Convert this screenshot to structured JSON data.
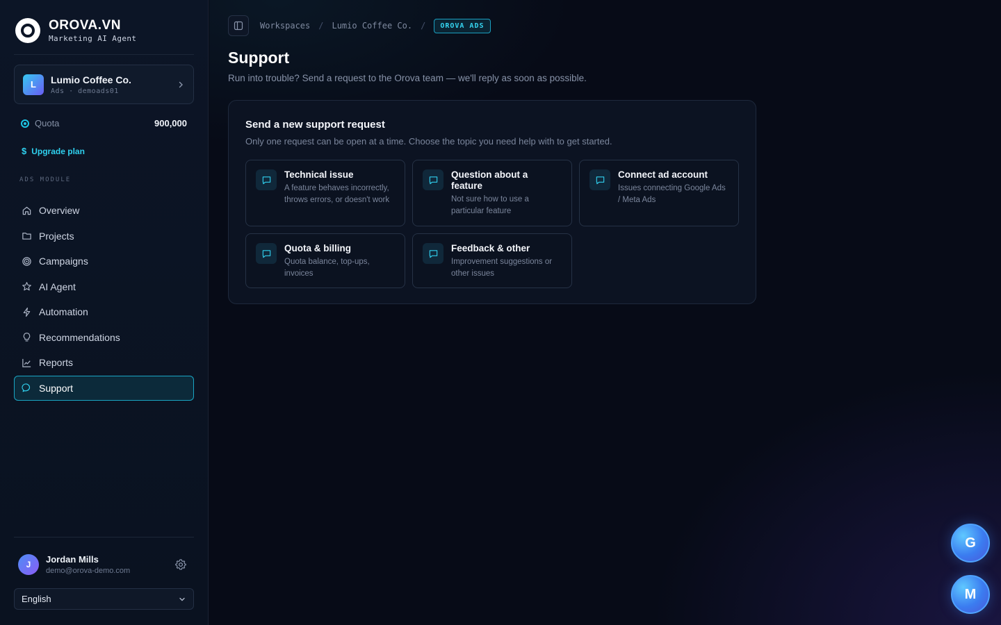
{
  "brand": {
    "name": "OROVA.VN",
    "subtitle": "Marketing AI Agent"
  },
  "workspace": {
    "initial": "L",
    "name": "Lumio Coffee Co.",
    "meta": "Ads · demoads01"
  },
  "quota": {
    "label": "Quota",
    "value": "900,000"
  },
  "upgrade": {
    "symbol": "$",
    "label": "Upgrade plan"
  },
  "sidebar": {
    "module_label": "ADS MODULE",
    "items": [
      {
        "label": "Overview",
        "icon": "home-icon"
      },
      {
        "label": "Projects",
        "icon": "folder-icon"
      },
      {
        "label": "Campaigns",
        "icon": "target-icon"
      },
      {
        "label": "AI Agent",
        "icon": "star-icon"
      },
      {
        "label": "Automation",
        "icon": "bolt-icon"
      },
      {
        "label": "Recommendations",
        "icon": "lightbulb-icon"
      },
      {
        "label": "Reports",
        "icon": "line-chart-icon"
      },
      {
        "label": "Support",
        "icon": "chat-icon",
        "active": true
      }
    ]
  },
  "user": {
    "initial": "J",
    "name": "Jordan Mills",
    "email": "demo@orova-demo.com"
  },
  "language": {
    "selected": "English"
  },
  "breadcrumb": {
    "items": [
      "Workspaces",
      "Lumio Coffee Co."
    ],
    "separator": "/",
    "badge": "OROVA ADS"
  },
  "page": {
    "title": "Support",
    "subtitle": "Run into trouble? Send a request to the Orova team — we'll reply as soon as possible."
  },
  "request_card": {
    "title": "Send a new support request",
    "subtitle": "Only one request can be open at a time. Choose the topic you need help with to get started.",
    "topics": [
      {
        "title": "Technical issue",
        "desc": "A feature behaves incorrectly, throws errors, or doesn't work"
      },
      {
        "title": "Question about a feature",
        "desc": "Not sure how to use a particular feature"
      },
      {
        "title": "Connect ad account",
        "desc": "Issues connecting Google Ads / Meta Ads"
      },
      {
        "title": "Quota & billing",
        "desc": "Quota balance, top-ups, invoices"
      },
      {
        "title": "Feedback & other",
        "desc": "Improvement suggestions or other issues"
      }
    ]
  },
  "floating": {
    "top_label": "G",
    "bottom_label": "M"
  },
  "colors": {
    "accent": "#1cc6e6",
    "background": "#070b17",
    "sidebar": "#0c1526"
  }
}
